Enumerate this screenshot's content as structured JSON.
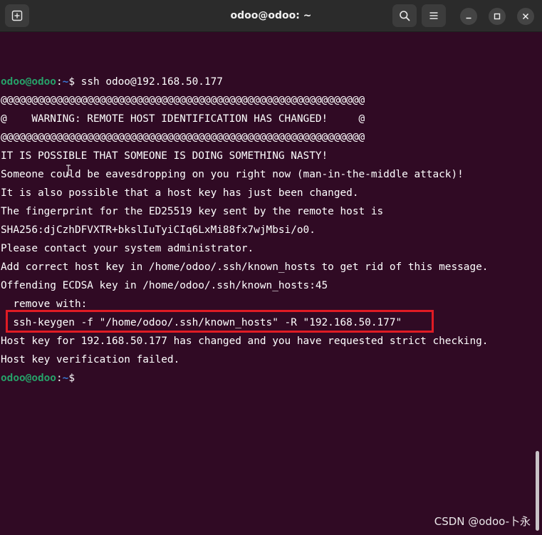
{
  "window": {
    "title": "odoo@odoo: ~",
    "icons": {
      "new_tab": "new-tab-icon",
      "search": "search-icon",
      "menu": "hamburger-menu-icon",
      "minimize": "minimize-icon",
      "maximize": "maximize-icon",
      "close": "close-icon"
    }
  },
  "colors": {
    "background": "#300a24",
    "prompt_user": "#26a269",
    "prompt_path": "#3a7ad8",
    "highlight_border": "#e01b24"
  },
  "terminal": {
    "prompt1": {
      "user": "odoo@odoo",
      "sep": ":",
      "path": "~",
      "symbol": "$",
      "command": " ssh odoo@192.168.50.177"
    },
    "lines": [
      "@@@@@@@@@@@@@@@@@@@@@@@@@@@@@@@@@@@@@@@@@@@@@@@@@@@@@@@@@@@",
      "@    WARNING: REMOTE HOST IDENTIFICATION HAS CHANGED!     @",
      "@@@@@@@@@@@@@@@@@@@@@@@@@@@@@@@@@@@@@@@@@@@@@@@@@@@@@@@@@@@",
      "IT IS POSSIBLE THAT SOMEONE IS DOING SOMETHING NASTY!",
      "Someone could be eavesdropping on you right now (man-in-the-middle attack)!",
      "It is also possible that a host key has just been changed.",
      "The fingerprint for the ED25519 key sent by the remote host is",
      "SHA256:djCzhDFVXTR+bkslIuTyiCIq6LxMi88fx7wjMbsi/o0.",
      "Please contact your system administrator.",
      "Add correct host key in /home/odoo/.ssh/known_hosts to get rid of this message.",
      "Offending ECDSA key in /home/odoo/.ssh/known_hosts:45",
      "  remove with:",
      "  ssh-keygen -f \"/home/odoo/.ssh/known_hosts\" -R \"192.168.50.177\"",
      "Host key for 192.168.50.177 has changed and you have requested strict checking.",
      "Host key verification failed."
    ],
    "prompt2": {
      "user": "odoo@odoo",
      "sep": ":",
      "path": "~",
      "symbol": "$",
      "command": ""
    }
  },
  "watermark": "CSDN @odoo-卜永"
}
